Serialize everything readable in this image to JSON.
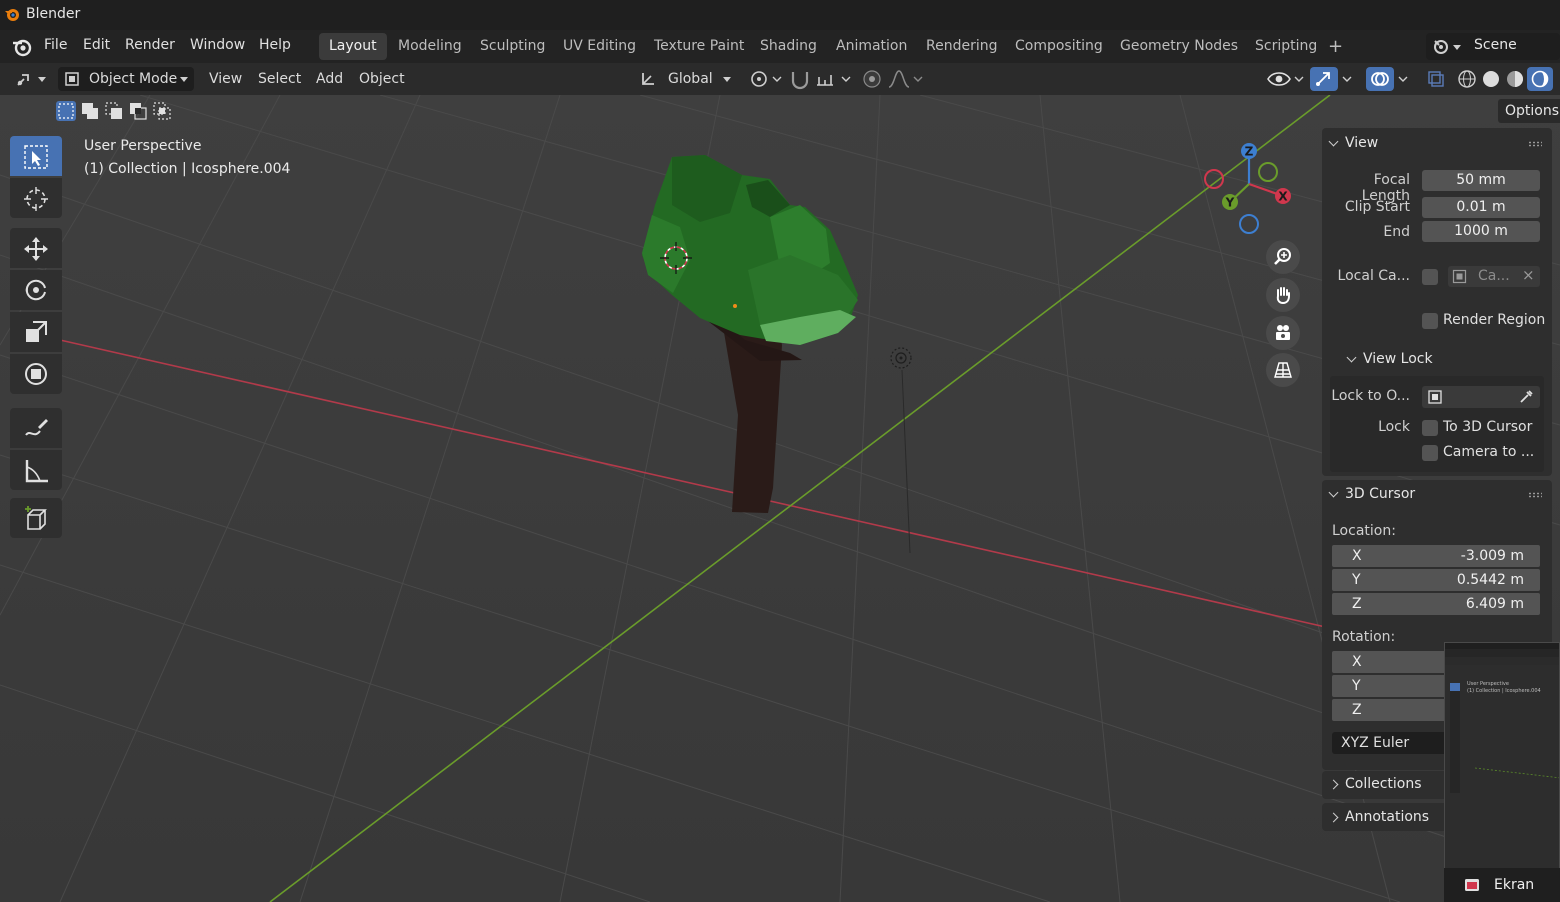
{
  "window": {
    "title": "Blender"
  },
  "menu": {
    "items": [
      "File",
      "Edit",
      "Render",
      "Window",
      "Help"
    ]
  },
  "workspaces": {
    "tabs": [
      "Layout",
      "Modeling",
      "Sculpting",
      "UV Editing",
      "Texture Paint",
      "Shading",
      "Animation",
      "Rendering",
      "Compositing",
      "Geometry Nodes",
      "Scripting"
    ],
    "active": "Layout"
  },
  "scene": {
    "label": "Scene"
  },
  "viewport_header": {
    "mode": "Object Mode",
    "menus": [
      "View",
      "Select",
      "Add",
      "Object"
    ],
    "transform_orientation": "Global"
  },
  "viewport": {
    "perspective": "User Perspective",
    "collection_info": "(1) Collection | Icosphere.004",
    "axis_x": "X",
    "axis_y": "Y",
    "axis_z": "Z"
  },
  "options_tab": "Options",
  "npanel": {
    "view": {
      "header": "View",
      "focal_length_label": "Focal Length",
      "focal_length": "50 mm",
      "clip_start_label": "Clip Start",
      "clip_start": "0.01 m",
      "clip_end_label": "End",
      "clip_end": "1000 m",
      "local_camera_label": "Local Ca...",
      "local_camera_value": "Ca...",
      "render_region_label": "Render Region",
      "view_lock_header": "View Lock",
      "lock_to_object_label": "Lock to O...",
      "lock_label": "Lock",
      "lock_to_cursor_label": "To 3D Cursor",
      "camera_to_view_label": "Camera to ..."
    },
    "cursor": {
      "header": "3D Cursor",
      "location_label": "Location:",
      "loc_x_label": "X",
      "loc_x": "-3.009 m",
      "loc_y_label": "Y",
      "loc_y": "0.5442 m",
      "loc_z_label": "Z",
      "loc_z": "6.409 m",
      "rotation_label": "Rotation:",
      "rot_x_label": "X",
      "rot_y_label": "Y",
      "rot_z_label": "Z",
      "rotation_mode": "XYZ Euler"
    },
    "collections": "Collections",
    "annotations": "Annotations"
  },
  "thumbnail": {
    "caption": "Ekran Alın",
    "perspective": "User Perspective",
    "collection_info": "(1) Collection | Icosphere.004"
  },
  "colors": {
    "accent": "#4772b3",
    "x_axis": "#d0374d",
    "y_axis": "#6a9c2b",
    "z_axis": "#3d7fd1"
  }
}
